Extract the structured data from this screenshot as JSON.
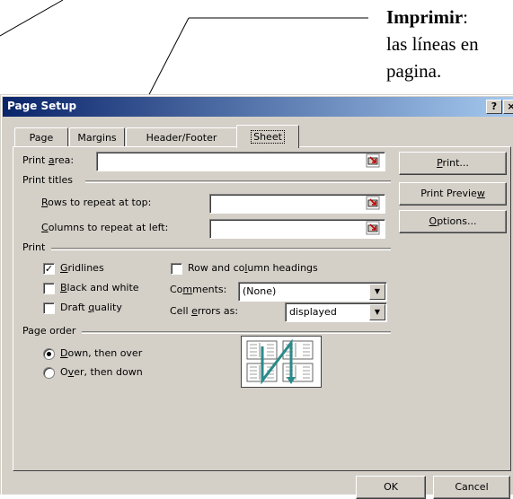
{
  "annotation": {
    "line1_bold": "Imprimir",
    "line1_rest": ":",
    "line2": "las líneas en",
    "line3": "pagina."
  },
  "dialog": {
    "title": "Page Setup",
    "help_button": "?",
    "close_button": "×",
    "tabs": [
      {
        "label": "Page"
      },
      {
        "label": "Margins"
      },
      {
        "label": "Header/Footer"
      },
      {
        "label": "Sheet",
        "active": true
      }
    ],
    "print_area": {
      "label": "Print area:",
      "value": ""
    },
    "print_titles": {
      "group_label": "Print titles",
      "rows_label": "Rows to repeat at top:",
      "rows_value": "",
      "cols_label": "Columns to repeat at left:",
      "cols_value": ""
    },
    "print": {
      "group_label": "Print",
      "gridlines": {
        "label": "Gridlines",
        "checked": true
      },
      "black_white": {
        "label": "Black and white",
        "checked": false
      },
      "draft": {
        "label": "Draft quality",
        "checked": false
      },
      "row_col_headings": {
        "label": "Row and column headings",
        "checked": false
      },
      "comments": {
        "label": "Comments:",
        "value": "(None)"
      },
      "cell_errors": {
        "label": "Cell errors as:",
        "value": "displayed"
      }
    },
    "page_order": {
      "group_label": "Page order",
      "down_then_over": {
        "label": "Down, then over",
        "selected": true
      },
      "over_then_down": {
        "label": "Over, then down",
        "selected": false
      }
    },
    "buttons": {
      "print": "Print...",
      "print_preview": "Print Preview",
      "options": "Options...",
      "ok": "OK",
      "cancel": "Cancel"
    }
  }
}
